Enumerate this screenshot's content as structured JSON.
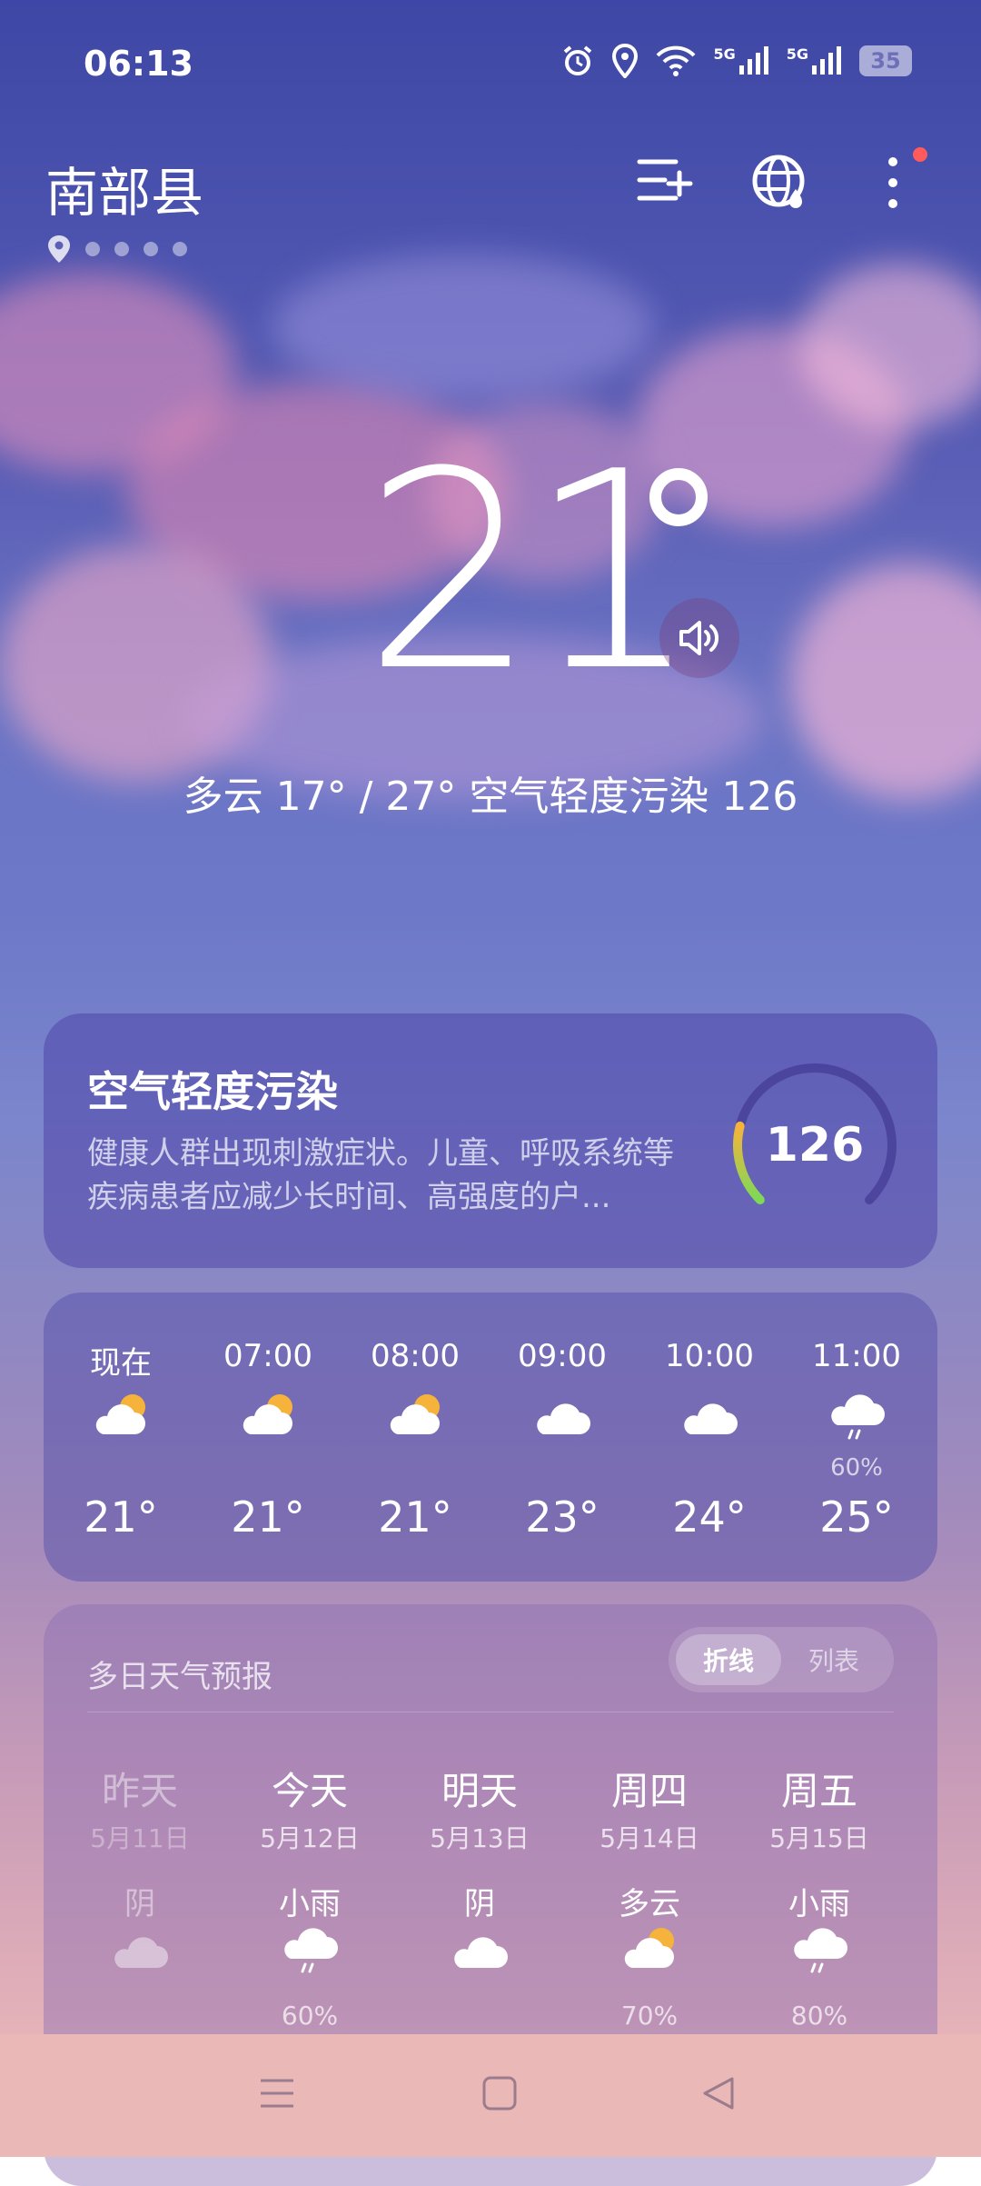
{
  "status_bar": {
    "time": "06:13",
    "battery": "35",
    "net1": "5G",
    "net2": "5G"
  },
  "header": {
    "city": "南部县"
  },
  "current": {
    "temperature": "21",
    "summary": "多云  17° / 27°  空气轻度污染 126"
  },
  "air_quality": {
    "title": "空气轻度污染",
    "description": "健康人群出现刺激症状。儿童、呼吸系统等疾病患者应减少长时间、高强度的户...",
    "aqi": "126",
    "aqi_fraction": 0.42
  },
  "hourly": [
    {
      "label": "现在",
      "icon": "partly-cloudy-icon",
      "prob": "",
      "temp": "21°"
    },
    {
      "label": "07:00",
      "icon": "partly-cloudy-icon",
      "prob": "",
      "temp": "21°"
    },
    {
      "label": "08:00",
      "icon": "partly-cloudy-icon",
      "prob": "",
      "temp": "21°"
    },
    {
      "label": "09:00",
      "icon": "cloud-icon",
      "prob": "",
      "temp": "23°"
    },
    {
      "label": "10:00",
      "icon": "cloud-icon",
      "prob": "",
      "temp": "24°"
    },
    {
      "label": "11:00",
      "icon": "light-rain-icon",
      "prob": "60%",
      "temp": "25°"
    }
  ],
  "daily": {
    "title": "多日天气预报",
    "toggle_line": "折线",
    "toggle_list": "列表",
    "days": [
      {
        "day": "昨天",
        "date": "5月11日",
        "cond": "阴",
        "icon": "overcast-icon",
        "prob": ""
      },
      {
        "day": "今天",
        "date": "5月12日",
        "cond": "小雨",
        "icon": "light-rain-icon",
        "prob": "60%"
      },
      {
        "day": "明天",
        "date": "5月13日",
        "cond": "阴",
        "icon": "overcast-icon",
        "prob": ""
      },
      {
        "day": "周四",
        "date": "5月14日",
        "cond": "多云",
        "icon": "partly-cloudy-icon",
        "prob": "70%"
      },
      {
        "day": "周五",
        "date": "5月15日",
        "cond": "小雨",
        "icon": "light-rain-icon",
        "prob": "80%"
      }
    ]
  },
  "colors": {
    "sun": "#f6b33c",
    "alert_dot": "#ff5b5b",
    "gauge_start": "#7ed957",
    "gauge_end": "#f6b33c"
  }
}
